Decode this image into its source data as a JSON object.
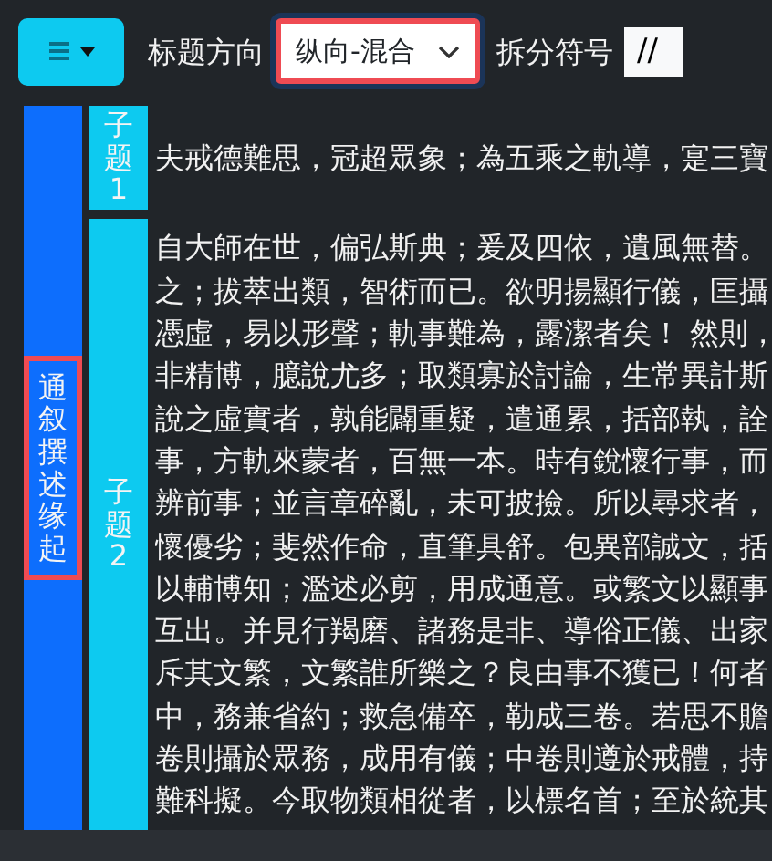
{
  "toolbar": {
    "title_direction": {
      "label": "标题方向",
      "value": "纵向-混合",
      "focused": true
    },
    "separator": {
      "label": "拆分符号",
      "value": "//"
    }
  },
  "section": {
    "title": "通叙撰述缘起",
    "highlighted": true,
    "subsections": [
      {
        "title": "子题1",
        "lines": [
          "夫戒德難思，冠超眾象；為五乘之軌導，寔三寶"
        ]
      },
      {
        "title": "子题2",
        "lines": [
          "自大師在世，偏弘斯典；爰及四依，遺風無替。",
          "之；拔萃出類，智術而已。欲明揚顯行儀，匡攝",
          "憑虛，易以形聲；軌事難為，露潔者矣！ 然則，",
          "非精博，臆說尤多；取類寡於討論，生常異計斯",
          "說之虛實者，孰能闢重疑，遣通累，括部執，詮",
          "事，方軌來蒙者，百無一本。時有銳懷行事，而",
          "辨前事；並言章碎亂，未可披撿。所以尋求者，",
          "懷優劣；斐然作命，直筆具舒。包異部誠文，括",
          "以輔博知；濫述必剪，用成通意。或繁文以顯事",
          "互出。并見行羯磨、諸務是非、導俗正儀、出家",
          "斥其文繁，文繁誰所樂之？良由事不獲已！何者",
          "中，務兼省約；救急備卒，勒成三卷。若思不贍",
          "卷則攝於眾務，成用有儀；中卷則遵於戒體，持",
          "難科擬。今取物類相從者，以標名首；至於統其"
        ]
      }
    ]
  }
}
